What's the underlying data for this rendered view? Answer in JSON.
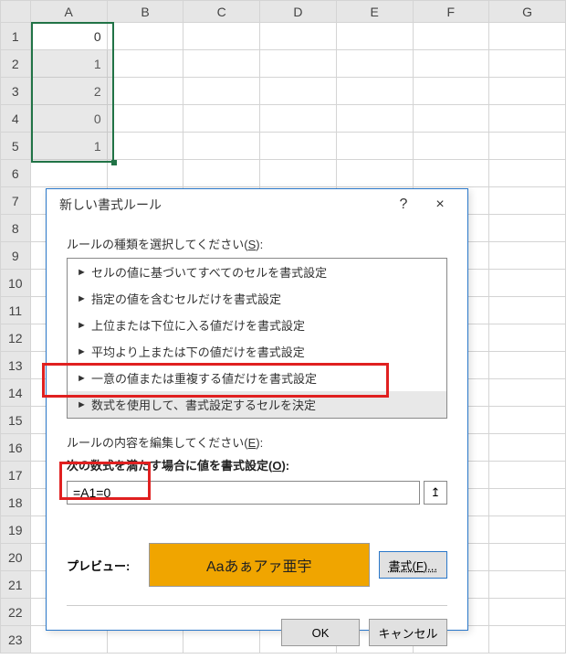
{
  "columns": [
    "A",
    "B",
    "C",
    "D",
    "E",
    "F",
    "G"
  ],
  "rows": [
    "1",
    "2",
    "3",
    "4",
    "5",
    "6",
    "7",
    "8",
    "9",
    "10",
    "11",
    "12",
    "13",
    "14",
    "15",
    "16",
    "17",
    "18",
    "19",
    "20",
    "21",
    "22",
    "23"
  ],
  "cells": {
    "A1": "0",
    "A2": "1",
    "A3": "2",
    "A4": "0",
    "A5": "1"
  },
  "dialog": {
    "title": "新しい書式ルール",
    "help_icon": "?",
    "close_icon": "×",
    "select_rule_label": "ルールの種類を選択してください(",
    "select_rule_key": "S",
    "select_rule_label2": "):",
    "rule_types": [
      "セルの値に基づいてすべてのセルを書式設定",
      "指定の値を含むセルだけを書式設定",
      "上位または下位に入る値だけを書式設定",
      "平均より上または下の値だけを書式設定",
      "一意の値または重複する値だけを書式設定",
      "数式を使用して、書式設定するセルを決定"
    ],
    "edit_rule_label": "ルールの内容を編集してください(",
    "edit_rule_key": "E",
    "edit_rule_label2": "):",
    "formula_label": "次の数式を満たす場合に値を書式設定(",
    "formula_key": "O",
    "formula_label2": "):",
    "formula_value": "=A1=0",
    "preview_label": "プレビュー:",
    "preview_sample": "Aaあぁアァ亜宇",
    "format_btn": "書式(",
    "format_btn_key": "F",
    "format_btn2": ")...",
    "ok_btn": "OK",
    "cancel_btn": "キャンセル"
  }
}
